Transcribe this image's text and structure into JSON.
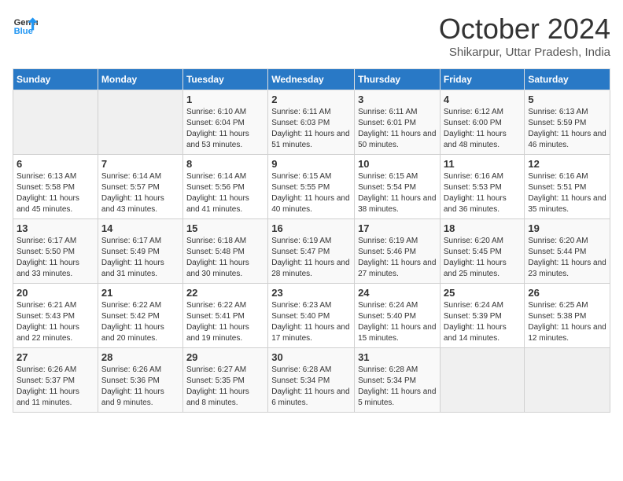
{
  "logo": {
    "text_general": "General",
    "text_blue": "Blue"
  },
  "title": "October 2024",
  "subtitle": "Shikarpur, Uttar Pradesh, India",
  "days_of_week": [
    "Sunday",
    "Monday",
    "Tuesday",
    "Wednesday",
    "Thursday",
    "Friday",
    "Saturday"
  ],
  "weeks": [
    [
      {
        "day": "",
        "sunrise": "",
        "sunset": "",
        "daylight": ""
      },
      {
        "day": "",
        "sunrise": "",
        "sunset": "",
        "daylight": ""
      },
      {
        "day": "1",
        "sunrise": "Sunrise: 6:10 AM",
        "sunset": "Sunset: 6:04 PM",
        "daylight": "Daylight: 11 hours and 53 minutes."
      },
      {
        "day": "2",
        "sunrise": "Sunrise: 6:11 AM",
        "sunset": "Sunset: 6:03 PM",
        "daylight": "Daylight: 11 hours and 51 minutes."
      },
      {
        "day": "3",
        "sunrise": "Sunrise: 6:11 AM",
        "sunset": "Sunset: 6:01 PM",
        "daylight": "Daylight: 11 hours and 50 minutes."
      },
      {
        "day": "4",
        "sunrise": "Sunrise: 6:12 AM",
        "sunset": "Sunset: 6:00 PM",
        "daylight": "Daylight: 11 hours and 48 minutes."
      },
      {
        "day": "5",
        "sunrise": "Sunrise: 6:13 AM",
        "sunset": "Sunset: 5:59 PM",
        "daylight": "Daylight: 11 hours and 46 minutes."
      }
    ],
    [
      {
        "day": "6",
        "sunrise": "Sunrise: 6:13 AM",
        "sunset": "Sunset: 5:58 PM",
        "daylight": "Daylight: 11 hours and 45 minutes."
      },
      {
        "day": "7",
        "sunrise": "Sunrise: 6:14 AM",
        "sunset": "Sunset: 5:57 PM",
        "daylight": "Daylight: 11 hours and 43 minutes."
      },
      {
        "day": "8",
        "sunrise": "Sunrise: 6:14 AM",
        "sunset": "Sunset: 5:56 PM",
        "daylight": "Daylight: 11 hours and 41 minutes."
      },
      {
        "day": "9",
        "sunrise": "Sunrise: 6:15 AM",
        "sunset": "Sunset: 5:55 PM",
        "daylight": "Daylight: 11 hours and 40 minutes."
      },
      {
        "day": "10",
        "sunrise": "Sunrise: 6:15 AM",
        "sunset": "Sunset: 5:54 PM",
        "daylight": "Daylight: 11 hours and 38 minutes."
      },
      {
        "day": "11",
        "sunrise": "Sunrise: 6:16 AM",
        "sunset": "Sunset: 5:53 PM",
        "daylight": "Daylight: 11 hours and 36 minutes."
      },
      {
        "day": "12",
        "sunrise": "Sunrise: 6:16 AM",
        "sunset": "Sunset: 5:51 PM",
        "daylight": "Daylight: 11 hours and 35 minutes."
      }
    ],
    [
      {
        "day": "13",
        "sunrise": "Sunrise: 6:17 AM",
        "sunset": "Sunset: 5:50 PM",
        "daylight": "Daylight: 11 hours and 33 minutes."
      },
      {
        "day": "14",
        "sunrise": "Sunrise: 6:17 AM",
        "sunset": "Sunset: 5:49 PM",
        "daylight": "Daylight: 11 hours and 31 minutes."
      },
      {
        "day": "15",
        "sunrise": "Sunrise: 6:18 AM",
        "sunset": "Sunset: 5:48 PM",
        "daylight": "Daylight: 11 hours and 30 minutes."
      },
      {
        "day": "16",
        "sunrise": "Sunrise: 6:19 AM",
        "sunset": "Sunset: 5:47 PM",
        "daylight": "Daylight: 11 hours and 28 minutes."
      },
      {
        "day": "17",
        "sunrise": "Sunrise: 6:19 AM",
        "sunset": "Sunset: 5:46 PM",
        "daylight": "Daylight: 11 hours and 27 minutes."
      },
      {
        "day": "18",
        "sunrise": "Sunrise: 6:20 AM",
        "sunset": "Sunset: 5:45 PM",
        "daylight": "Daylight: 11 hours and 25 minutes."
      },
      {
        "day": "19",
        "sunrise": "Sunrise: 6:20 AM",
        "sunset": "Sunset: 5:44 PM",
        "daylight": "Daylight: 11 hours and 23 minutes."
      }
    ],
    [
      {
        "day": "20",
        "sunrise": "Sunrise: 6:21 AM",
        "sunset": "Sunset: 5:43 PM",
        "daylight": "Daylight: 11 hours and 22 minutes."
      },
      {
        "day": "21",
        "sunrise": "Sunrise: 6:22 AM",
        "sunset": "Sunset: 5:42 PM",
        "daylight": "Daylight: 11 hours and 20 minutes."
      },
      {
        "day": "22",
        "sunrise": "Sunrise: 6:22 AM",
        "sunset": "Sunset: 5:41 PM",
        "daylight": "Daylight: 11 hours and 19 minutes."
      },
      {
        "day": "23",
        "sunrise": "Sunrise: 6:23 AM",
        "sunset": "Sunset: 5:40 PM",
        "daylight": "Daylight: 11 hours and 17 minutes."
      },
      {
        "day": "24",
        "sunrise": "Sunrise: 6:24 AM",
        "sunset": "Sunset: 5:40 PM",
        "daylight": "Daylight: 11 hours and 15 minutes."
      },
      {
        "day": "25",
        "sunrise": "Sunrise: 6:24 AM",
        "sunset": "Sunset: 5:39 PM",
        "daylight": "Daylight: 11 hours and 14 minutes."
      },
      {
        "day": "26",
        "sunrise": "Sunrise: 6:25 AM",
        "sunset": "Sunset: 5:38 PM",
        "daylight": "Daylight: 11 hours and 12 minutes."
      }
    ],
    [
      {
        "day": "27",
        "sunrise": "Sunrise: 6:26 AM",
        "sunset": "Sunset: 5:37 PM",
        "daylight": "Daylight: 11 hours and 11 minutes."
      },
      {
        "day": "28",
        "sunrise": "Sunrise: 6:26 AM",
        "sunset": "Sunset: 5:36 PM",
        "daylight": "Daylight: 11 hours and 9 minutes."
      },
      {
        "day": "29",
        "sunrise": "Sunrise: 6:27 AM",
        "sunset": "Sunset: 5:35 PM",
        "daylight": "Daylight: 11 hours and 8 minutes."
      },
      {
        "day": "30",
        "sunrise": "Sunrise: 6:28 AM",
        "sunset": "Sunset: 5:34 PM",
        "daylight": "Daylight: 11 hours and 6 minutes."
      },
      {
        "day": "31",
        "sunrise": "Sunrise: 6:28 AM",
        "sunset": "Sunset: 5:34 PM",
        "daylight": "Daylight: 11 hours and 5 minutes."
      },
      {
        "day": "",
        "sunrise": "",
        "sunset": "",
        "daylight": ""
      },
      {
        "day": "",
        "sunrise": "",
        "sunset": "",
        "daylight": ""
      }
    ]
  ]
}
